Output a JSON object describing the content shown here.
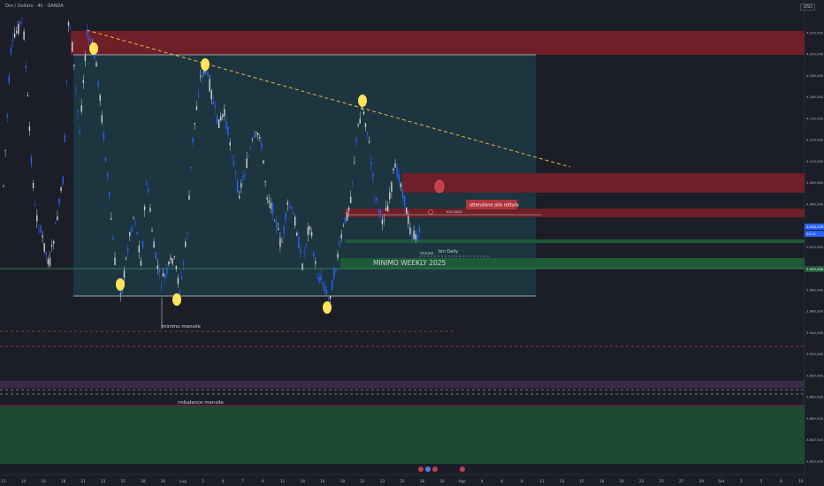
{
  "header": {
    "symbol": "Oro / Dollaro · 4h · OANDA",
    "currency": "USD"
  },
  "chart_data": {
    "type": "candlestick",
    "y_ticks": [
      4220000,
      4200000,
      4180000,
      4160000,
      4140000,
      4120000,
      4100000,
      4080000,
      4060000,
      4040000,
      4020000,
      4000000,
      3980000,
      3960000,
      3940000,
      3920000,
      3900000,
      3880000,
      3860000,
      3840000,
      3820000
    ],
    "y_tick_labels": [
      "4.220,000",
      "4.200,000",
      "4.180,000",
      "4.160,000",
      "4.140,000",
      "4.120,000",
      "4.100,000",
      "4.080,000",
      "4.060,000",
      "4.040,000",
      "4.020,000",
      "4.000,000",
      "3.980,000",
      "3.960,000",
      "3.940,000",
      "3.920,000",
      "3.900,000",
      "3.880,000",
      "3.860,000",
      "3.840,000",
      "3.820,000"
    ],
    "x_labels": [
      "11",
      "14",
      "16",
      "18",
      "21",
      "23",
      "25",
      "28",
      "30",
      "Lug",
      "2",
      "4",
      "7",
      "9",
      "11",
      "14",
      "16",
      "18",
      "21",
      "23",
      "25",
      "28",
      "30",
      "Ago",
      "4",
      "6",
      "8",
      "11",
      "13",
      "15",
      "18",
      "20",
      "22",
      "25",
      "27",
      "29",
      "Set",
      "3",
      "5",
      "8",
      "10"
    ],
    "price_labels": {
      "bid": "4.036,378",
      "timer": "20:11",
      "level": "3.999,956"
    },
    "annotations": {
      "minimo_mensile": "minimo mensile",
      "imbalance_mensile": "imbalance mensile",
      "minimo_weekly": "MINIMO WEEKLY 2025",
      "bos_daily": "BOS DAILY",
      "attenzione": "attenzione alla rottura",
      "minimi": "minimi",
      "bin_daily": "bin Daily"
    },
    "colors": {
      "bull": "#2962ff",
      "bear": "#d1d4dc",
      "supply": "#6e1f27",
      "demand": "#1e5a38",
      "highlight": "#ffe35a"
    }
  }
}
